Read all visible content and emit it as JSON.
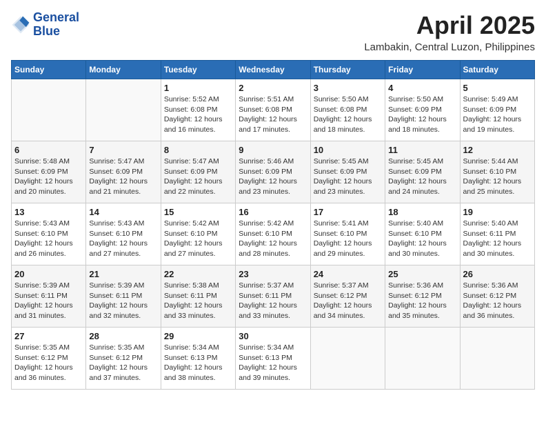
{
  "header": {
    "logo_line1": "General",
    "logo_line2": "Blue",
    "month": "April 2025",
    "location": "Lambakin, Central Luzon, Philippines"
  },
  "weekdays": [
    "Sunday",
    "Monday",
    "Tuesday",
    "Wednesday",
    "Thursday",
    "Friday",
    "Saturday"
  ],
  "weeks": [
    [
      {
        "day": "",
        "info": ""
      },
      {
        "day": "",
        "info": ""
      },
      {
        "day": "1",
        "info": "Sunrise: 5:52 AM\nSunset: 6:08 PM\nDaylight: 12 hours and 16 minutes."
      },
      {
        "day": "2",
        "info": "Sunrise: 5:51 AM\nSunset: 6:08 PM\nDaylight: 12 hours and 17 minutes."
      },
      {
        "day": "3",
        "info": "Sunrise: 5:50 AM\nSunset: 6:08 PM\nDaylight: 12 hours and 18 minutes."
      },
      {
        "day": "4",
        "info": "Sunrise: 5:50 AM\nSunset: 6:09 PM\nDaylight: 12 hours and 18 minutes."
      },
      {
        "day": "5",
        "info": "Sunrise: 5:49 AM\nSunset: 6:09 PM\nDaylight: 12 hours and 19 minutes."
      }
    ],
    [
      {
        "day": "6",
        "info": "Sunrise: 5:48 AM\nSunset: 6:09 PM\nDaylight: 12 hours and 20 minutes."
      },
      {
        "day": "7",
        "info": "Sunrise: 5:47 AM\nSunset: 6:09 PM\nDaylight: 12 hours and 21 minutes."
      },
      {
        "day": "8",
        "info": "Sunrise: 5:47 AM\nSunset: 6:09 PM\nDaylight: 12 hours and 22 minutes."
      },
      {
        "day": "9",
        "info": "Sunrise: 5:46 AM\nSunset: 6:09 PM\nDaylight: 12 hours and 23 minutes."
      },
      {
        "day": "10",
        "info": "Sunrise: 5:45 AM\nSunset: 6:09 PM\nDaylight: 12 hours and 23 minutes."
      },
      {
        "day": "11",
        "info": "Sunrise: 5:45 AM\nSunset: 6:09 PM\nDaylight: 12 hours and 24 minutes."
      },
      {
        "day": "12",
        "info": "Sunrise: 5:44 AM\nSunset: 6:10 PM\nDaylight: 12 hours and 25 minutes."
      }
    ],
    [
      {
        "day": "13",
        "info": "Sunrise: 5:43 AM\nSunset: 6:10 PM\nDaylight: 12 hours and 26 minutes."
      },
      {
        "day": "14",
        "info": "Sunrise: 5:43 AM\nSunset: 6:10 PM\nDaylight: 12 hours and 27 minutes."
      },
      {
        "day": "15",
        "info": "Sunrise: 5:42 AM\nSunset: 6:10 PM\nDaylight: 12 hours and 27 minutes."
      },
      {
        "day": "16",
        "info": "Sunrise: 5:42 AM\nSunset: 6:10 PM\nDaylight: 12 hours and 28 minutes."
      },
      {
        "day": "17",
        "info": "Sunrise: 5:41 AM\nSunset: 6:10 PM\nDaylight: 12 hours and 29 minutes."
      },
      {
        "day": "18",
        "info": "Sunrise: 5:40 AM\nSunset: 6:10 PM\nDaylight: 12 hours and 30 minutes."
      },
      {
        "day": "19",
        "info": "Sunrise: 5:40 AM\nSunset: 6:11 PM\nDaylight: 12 hours and 30 minutes."
      }
    ],
    [
      {
        "day": "20",
        "info": "Sunrise: 5:39 AM\nSunset: 6:11 PM\nDaylight: 12 hours and 31 minutes."
      },
      {
        "day": "21",
        "info": "Sunrise: 5:39 AM\nSunset: 6:11 PM\nDaylight: 12 hours and 32 minutes."
      },
      {
        "day": "22",
        "info": "Sunrise: 5:38 AM\nSunset: 6:11 PM\nDaylight: 12 hours and 33 minutes."
      },
      {
        "day": "23",
        "info": "Sunrise: 5:37 AM\nSunset: 6:11 PM\nDaylight: 12 hours and 33 minutes."
      },
      {
        "day": "24",
        "info": "Sunrise: 5:37 AM\nSunset: 6:12 PM\nDaylight: 12 hours and 34 minutes."
      },
      {
        "day": "25",
        "info": "Sunrise: 5:36 AM\nSunset: 6:12 PM\nDaylight: 12 hours and 35 minutes."
      },
      {
        "day": "26",
        "info": "Sunrise: 5:36 AM\nSunset: 6:12 PM\nDaylight: 12 hours and 36 minutes."
      }
    ],
    [
      {
        "day": "27",
        "info": "Sunrise: 5:35 AM\nSunset: 6:12 PM\nDaylight: 12 hours and 36 minutes."
      },
      {
        "day": "28",
        "info": "Sunrise: 5:35 AM\nSunset: 6:12 PM\nDaylight: 12 hours and 37 minutes."
      },
      {
        "day": "29",
        "info": "Sunrise: 5:34 AM\nSunset: 6:13 PM\nDaylight: 12 hours and 38 minutes."
      },
      {
        "day": "30",
        "info": "Sunrise: 5:34 AM\nSunset: 6:13 PM\nDaylight: 12 hours and 39 minutes."
      },
      {
        "day": "",
        "info": ""
      },
      {
        "day": "",
        "info": ""
      },
      {
        "day": "",
        "info": ""
      }
    ]
  ]
}
